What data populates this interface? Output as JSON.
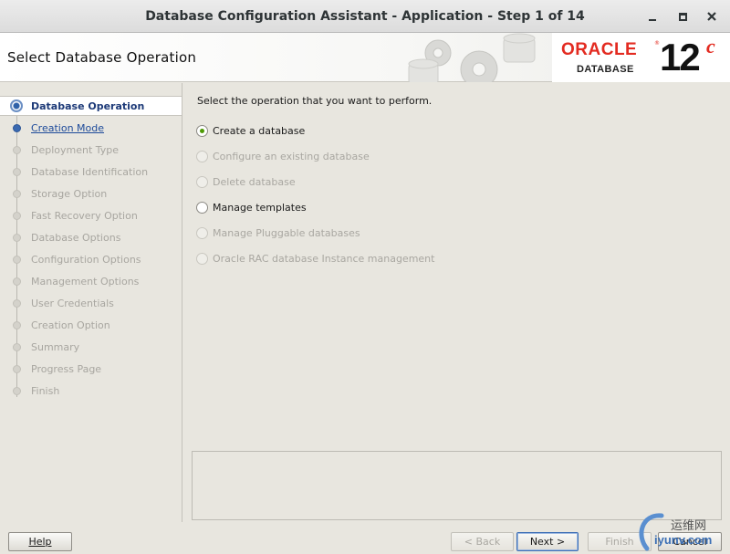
{
  "window": {
    "title": "Database Configuration Assistant - Application - Step 1 of 14"
  },
  "header": {
    "page_title": "Select Database Operation",
    "brand": {
      "oracle": "ORACLE",
      "database": "DATABASE",
      "version_num": "12",
      "version_letter": "c"
    }
  },
  "steps": [
    {
      "label": "Database Operation",
      "state": "active"
    },
    {
      "label": "Creation Mode",
      "state": "link"
    },
    {
      "label": "Deployment Type",
      "state": "disabled"
    },
    {
      "label": "Database Identification",
      "state": "disabled"
    },
    {
      "label": "Storage Option",
      "state": "disabled"
    },
    {
      "label": "Fast Recovery Option",
      "state": "disabled"
    },
    {
      "label": "Database Options",
      "state": "disabled"
    },
    {
      "label": "Configuration Options",
      "state": "disabled"
    },
    {
      "label": "Management Options",
      "state": "disabled"
    },
    {
      "label": "User Credentials",
      "state": "disabled"
    },
    {
      "label": "Creation Option",
      "state": "disabled"
    },
    {
      "label": "Summary",
      "state": "disabled"
    },
    {
      "label": "Progress Page",
      "state": "disabled"
    },
    {
      "label": "Finish",
      "state": "disabled"
    }
  ],
  "content": {
    "instruction": "Select the operation that you want to perform.",
    "options": [
      {
        "label": "Create a database",
        "selected": true,
        "enabled": true
      },
      {
        "label": "Configure an existing database",
        "selected": false,
        "enabled": false
      },
      {
        "label": "Delete database",
        "selected": false,
        "enabled": false
      },
      {
        "label": "Manage templates",
        "selected": false,
        "enabled": true
      },
      {
        "label": "Manage Pluggable databases",
        "selected": false,
        "enabled": false
      },
      {
        "label": "Oracle RAC database Instance management",
        "selected": false,
        "enabled": false
      }
    ]
  },
  "buttons": {
    "help": "Help",
    "back": "< Back",
    "next": "Next >",
    "finish": "Finish",
    "cancel": "Cancel"
  },
  "watermark": {
    "line1": "运维网",
    "line2": "iyunv.com"
  },
  "colors": {
    "accent_blue": "#1d3a78",
    "oracle_red": "#e32b21",
    "selected_radio": "#4e9a06",
    "panel_bg": "#e8e6df"
  }
}
